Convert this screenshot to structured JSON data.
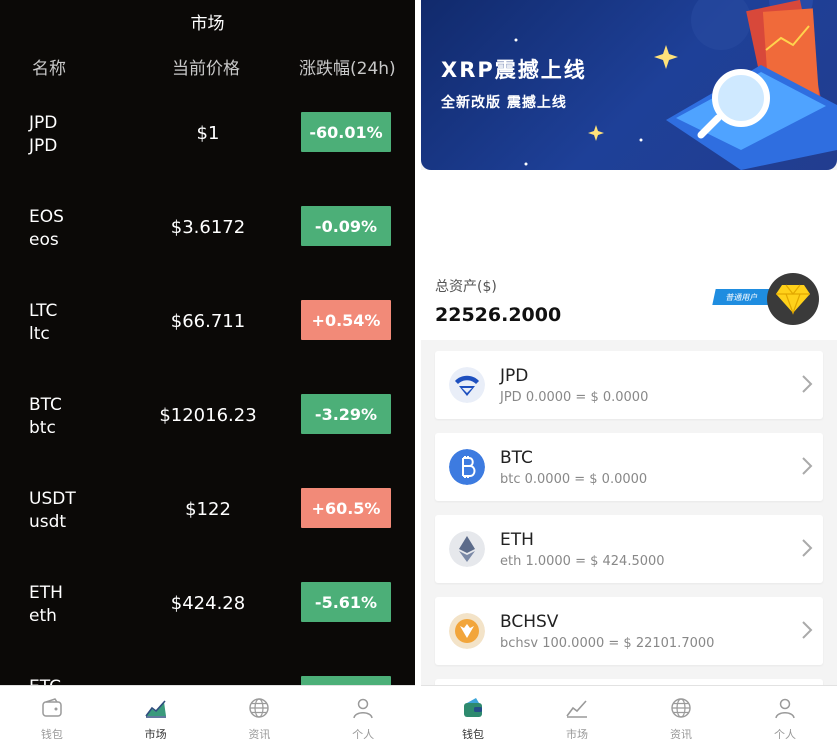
{
  "market": {
    "title": "市场",
    "headers": {
      "name": "名称",
      "price": "当前价格",
      "change": "涨跌幅(24h)"
    },
    "rows": [
      {
        "symbol": "JPD",
        "sub": "JPD",
        "price": "$1",
        "change": "-60.01%",
        "trend": "down"
      },
      {
        "symbol": "EOS",
        "sub": "eos",
        "price": "$3.6172",
        "change": "-0.09%",
        "trend": "down"
      },
      {
        "symbol": "LTC",
        "sub": "ltc",
        "price": "$66.711",
        "change": "+0.54%",
        "trend": "up"
      },
      {
        "symbol": "BTC",
        "sub": "btc",
        "price": "$12016.23",
        "change": "-3.29%",
        "trend": "down"
      },
      {
        "symbol": "USDT",
        "sub": "usdt",
        "price": "$122",
        "change": "+60.5%",
        "trend": "up"
      },
      {
        "symbol": "ETH",
        "sub": "eth",
        "price": "$424.28",
        "change": "-5.61%",
        "trend": "down"
      },
      {
        "symbol": "ETC",
        "sub": "",
        "price": "",
        "change": "",
        "trend": "down"
      }
    ]
  },
  "tabs": [
    {
      "label": "钱包",
      "icon": "wallet-icon"
    },
    {
      "label": "市场",
      "icon": "market-chart-icon"
    },
    {
      "label": "资讯",
      "icon": "globe-icon"
    },
    {
      "label": "个人",
      "icon": "user-icon"
    }
  ],
  "wallet": {
    "banner": {
      "headline": "XRP震撼上线",
      "subline": "全新改版 震撼上线"
    },
    "total_label": "总资产($)",
    "total_value": "22526.2000",
    "vip_label": "普通用户",
    "assets": [
      {
        "name": "JPD",
        "desc": "JPD 0.0000 = $ 0.0000",
        "icon": "jpd-coin-icon"
      },
      {
        "name": "BTC",
        "desc": "btc 0.0000 = $ 0.0000",
        "icon": "btc-coin-icon"
      },
      {
        "name": "ETH",
        "desc": "eth 1.0000 = $ 424.5000",
        "icon": "eth-coin-icon"
      },
      {
        "name": "BCHSV",
        "desc": "bchsv 100.0000 = $ 22101.7000",
        "icon": "bchsv-coin-icon"
      }
    ]
  },
  "colors": {
    "down": "#4caf78",
    "up": "#f28a78",
    "left_bg": "#0b0907",
    "accent": "#1f8de0"
  }
}
